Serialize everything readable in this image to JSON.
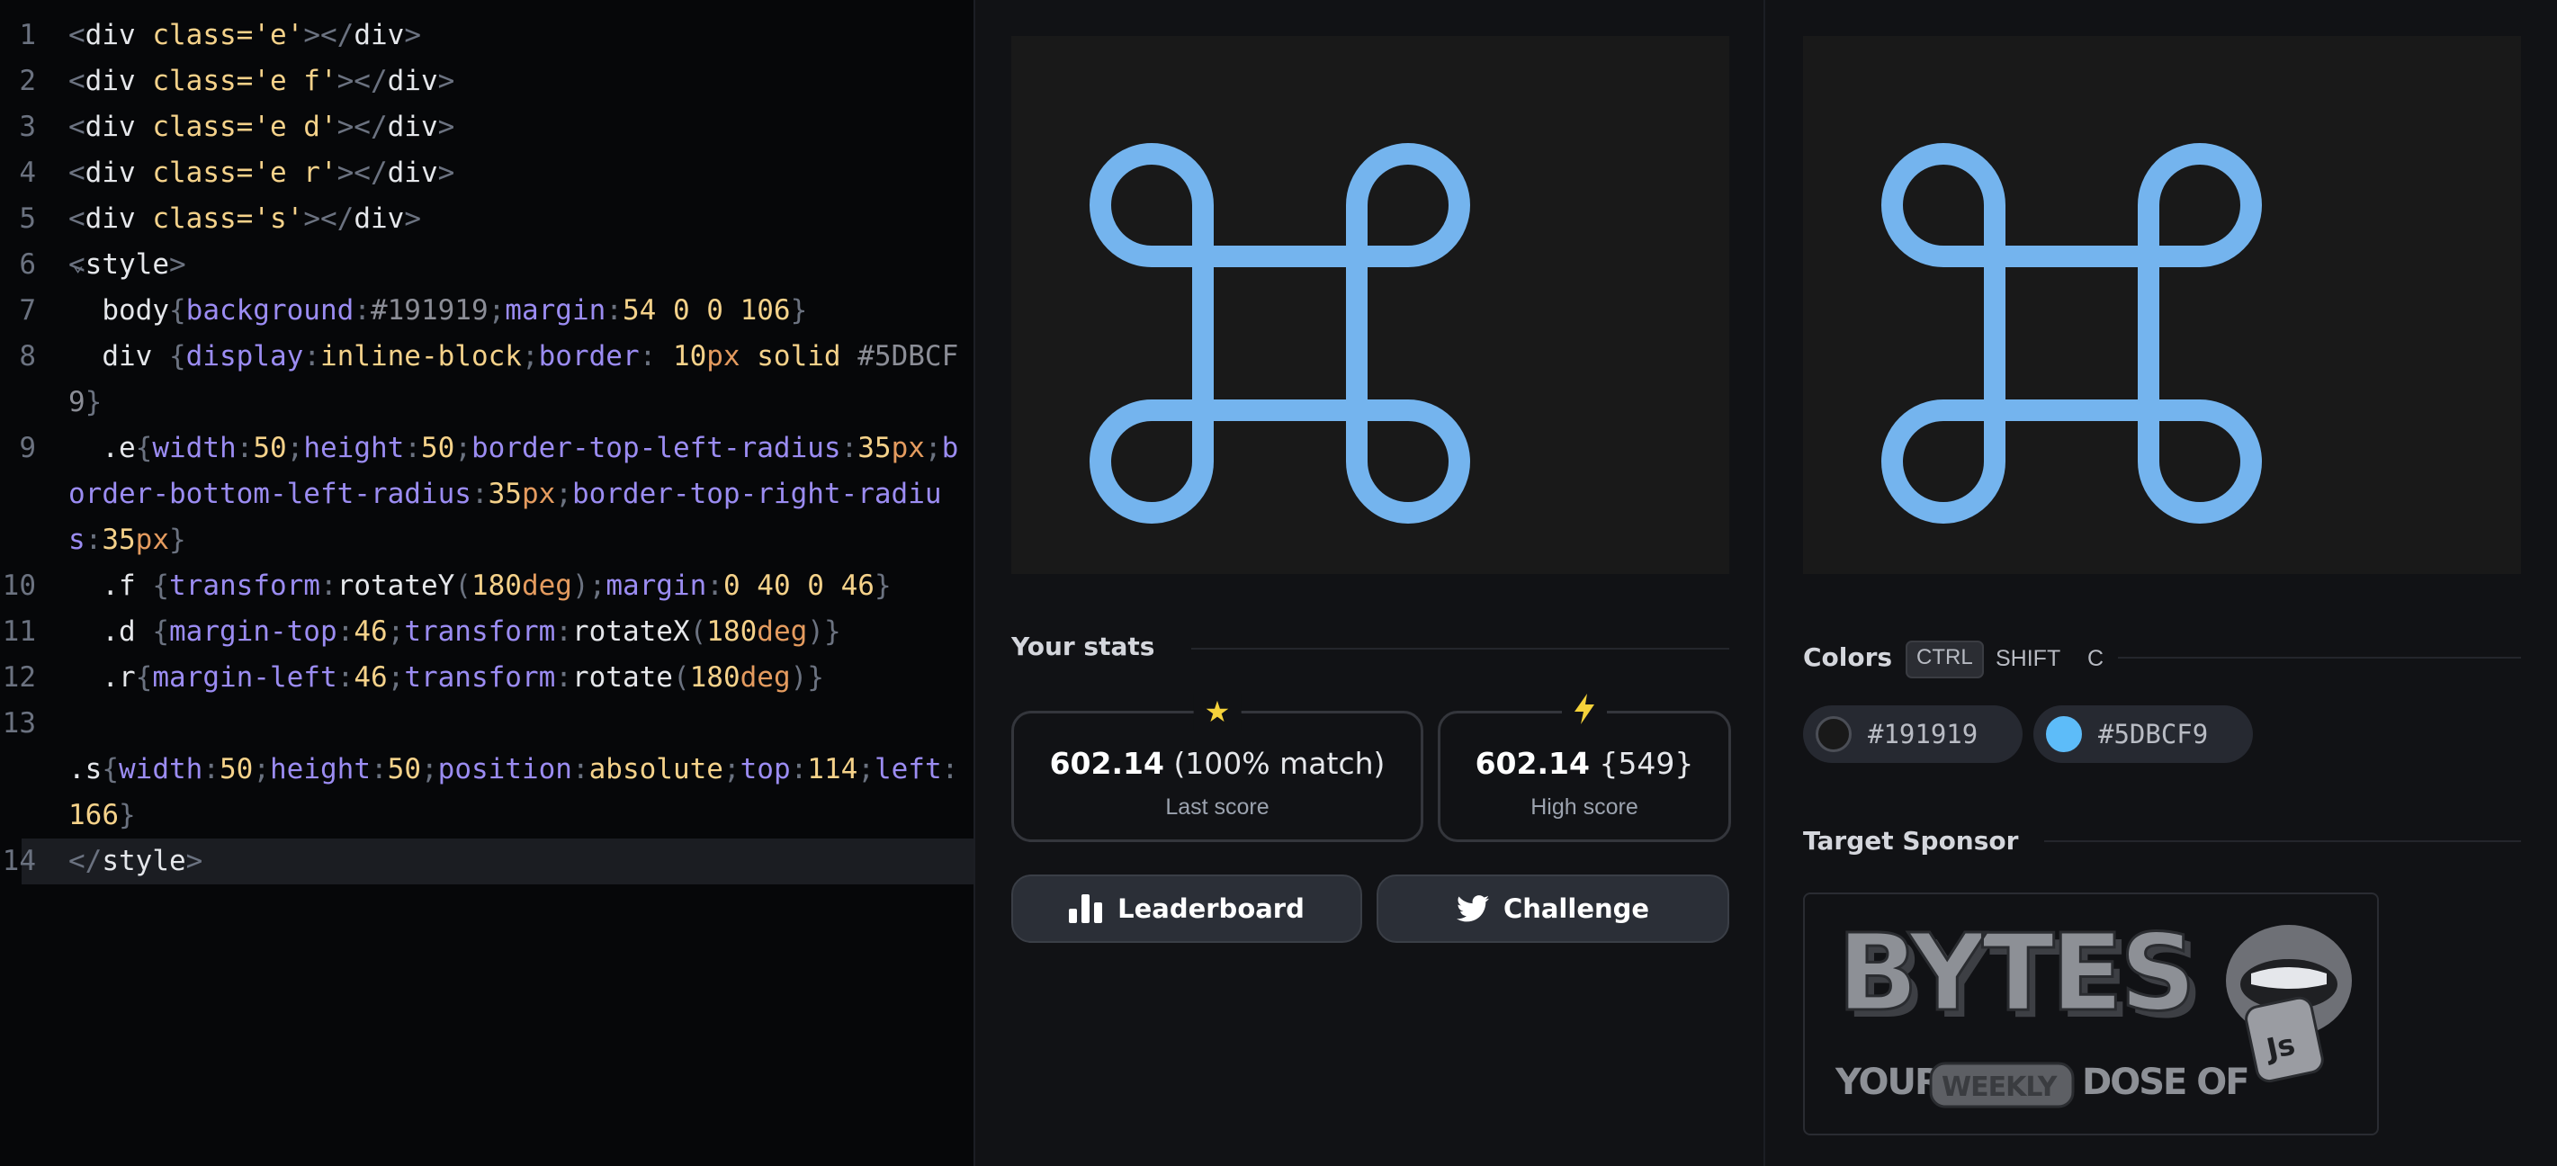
{
  "editor": {
    "lines": [
      {
        "n": "1",
        "parts": [
          [
            "t-punc",
            "<"
          ],
          [
            "t-tag",
            "div "
          ],
          [
            "t-attr",
            "class="
          ],
          [
            "t-str",
            "'e'"
          ],
          [
            "t-punc",
            "></"
          ],
          [
            "t-tag",
            "div"
          ],
          [
            "t-punc",
            ">"
          ]
        ]
      },
      {
        "n": "2",
        "parts": [
          [
            "t-punc",
            "<"
          ],
          [
            "t-tag",
            "div "
          ],
          [
            "t-attr",
            "class="
          ],
          [
            "t-str",
            "'e f'"
          ],
          [
            "t-punc",
            "></"
          ],
          [
            "t-tag",
            "div"
          ],
          [
            "t-punc",
            ">"
          ]
        ]
      },
      {
        "n": "3",
        "parts": [
          [
            "t-punc",
            "<"
          ],
          [
            "t-tag",
            "div "
          ],
          [
            "t-attr",
            "class="
          ],
          [
            "t-str",
            "'e d'"
          ],
          [
            "t-punc",
            "></"
          ],
          [
            "t-tag",
            "div"
          ],
          [
            "t-punc",
            ">"
          ]
        ]
      },
      {
        "n": "4",
        "parts": [
          [
            "t-punc",
            "<"
          ],
          [
            "t-tag",
            "div "
          ],
          [
            "t-attr",
            "class="
          ],
          [
            "t-str",
            "'e r'"
          ],
          [
            "t-punc",
            "></"
          ],
          [
            "t-tag",
            "div"
          ],
          [
            "t-punc",
            ">"
          ]
        ]
      },
      {
        "n": "5",
        "parts": [
          [
            "t-punc",
            "<"
          ],
          [
            "t-tag",
            "div "
          ],
          [
            "t-attr",
            "class="
          ],
          [
            "t-str",
            "'s'"
          ],
          [
            "t-punc",
            "></"
          ],
          [
            "t-tag",
            "div"
          ],
          [
            "t-punc",
            ">"
          ]
        ]
      },
      {
        "n": "6",
        "fold": "⌄",
        "parts": [
          [
            "t-punc",
            "<"
          ],
          [
            "t-tag",
            "style"
          ],
          [
            "t-punc",
            ">"
          ]
        ]
      },
      {
        "n": "7",
        "parts": [
          [
            "t-sel",
            "  body"
          ],
          [
            "t-punc",
            "{"
          ],
          [
            "t-prop",
            "background"
          ],
          [
            "t-punc",
            ":"
          ],
          [
            "t-hex",
            "#191919"
          ],
          [
            "t-punc",
            ";"
          ],
          [
            "t-prop",
            "margin"
          ],
          [
            "t-punc",
            ":"
          ],
          [
            "t-val",
            "54 0 0 106"
          ],
          [
            "t-punc",
            "}"
          ]
        ]
      },
      {
        "n": "8",
        "parts": [
          [
            "t-sel",
            "  div "
          ],
          [
            "t-punc",
            "{"
          ],
          [
            "t-prop",
            "display"
          ],
          [
            "t-punc",
            ":"
          ],
          [
            "t-val",
            "inline-block"
          ],
          [
            "t-punc",
            ";"
          ],
          [
            "t-prop",
            "border"
          ],
          [
            "t-punc",
            ": "
          ],
          [
            "t-val",
            "10"
          ],
          [
            "t-unit",
            "px"
          ],
          [
            "t-val",
            " solid "
          ],
          [
            "t-hex",
            "#5DBCF9"
          ],
          [
            "t-punc",
            "}"
          ]
        ]
      },
      {
        "n": "9",
        "parts": [
          [
            "t-sel",
            "  .e"
          ],
          [
            "t-punc",
            "{"
          ],
          [
            "t-prop",
            "width"
          ],
          [
            "t-punc",
            ":"
          ],
          [
            "t-val",
            "50"
          ],
          [
            "t-punc",
            ";"
          ],
          [
            "t-prop",
            "height"
          ],
          [
            "t-punc",
            ":"
          ],
          [
            "t-val",
            "50"
          ],
          [
            "t-punc",
            ";"
          ],
          [
            "t-prop",
            "border-top-left-radius"
          ],
          [
            "t-punc",
            ":"
          ],
          [
            "t-val",
            "35"
          ],
          [
            "t-unit",
            "px"
          ],
          [
            "t-punc",
            ";"
          ],
          [
            "t-prop",
            "border-bottom-left-radius"
          ],
          [
            "t-punc",
            ":"
          ],
          [
            "t-val",
            "35"
          ],
          [
            "t-unit",
            "px"
          ],
          [
            "t-punc",
            ";"
          ],
          [
            "t-prop",
            "border-top-right-radius"
          ],
          [
            "t-punc",
            ":"
          ],
          [
            "t-val",
            "35"
          ],
          [
            "t-unit",
            "px"
          ],
          [
            "t-punc",
            "}"
          ]
        ]
      },
      {
        "n": "10",
        "parts": [
          [
            "t-sel",
            "  .f "
          ],
          [
            "t-punc",
            "{"
          ],
          [
            "t-prop",
            "transform"
          ],
          [
            "t-punc",
            ":"
          ],
          [
            "t-fn",
            "rotateY"
          ],
          [
            "t-punc",
            "("
          ],
          [
            "t-val",
            "180"
          ],
          [
            "t-unit",
            "deg"
          ],
          [
            "t-punc",
            ");"
          ],
          [
            "t-prop",
            "margin"
          ],
          [
            "t-punc",
            ":"
          ],
          [
            "t-val",
            "0 40 0 46"
          ],
          [
            "t-punc",
            "}"
          ]
        ]
      },
      {
        "n": "11",
        "parts": [
          [
            "t-sel",
            "  .d "
          ],
          [
            "t-punc",
            "{"
          ],
          [
            "t-prop",
            "margin-top"
          ],
          [
            "t-punc",
            ":"
          ],
          [
            "t-val",
            "46"
          ],
          [
            "t-punc",
            ";"
          ],
          [
            "t-prop",
            "transform"
          ],
          [
            "t-punc",
            ":"
          ],
          [
            "t-fn",
            "rotateX"
          ],
          [
            "t-punc",
            "("
          ],
          [
            "t-val",
            "180"
          ],
          [
            "t-unit",
            "deg"
          ],
          [
            "t-punc",
            ")}"
          ]
        ]
      },
      {
        "n": "12",
        "parts": [
          [
            "t-sel",
            "  .r"
          ],
          [
            "t-punc",
            "{"
          ],
          [
            "t-prop",
            "margin-left"
          ],
          [
            "t-punc",
            ":"
          ],
          [
            "t-val",
            "46"
          ],
          [
            "t-punc",
            ";"
          ],
          [
            "t-prop",
            "transform"
          ],
          [
            "t-punc",
            ":"
          ],
          [
            "t-fn",
            "rotate"
          ],
          [
            "t-punc",
            "("
          ],
          [
            "t-val",
            "180"
          ],
          [
            "t-unit",
            "deg"
          ],
          [
            "t-punc",
            ")}"
          ]
        ]
      },
      {
        "n": "13",
        "parts": [
          [
            "t-com",
            "\n"
          ],
          [
            "t-sel",
            ".s"
          ],
          [
            "t-punc",
            "{"
          ],
          [
            "t-prop",
            "width"
          ],
          [
            "t-punc",
            ":"
          ],
          [
            "t-val",
            "50"
          ],
          [
            "t-punc",
            ";"
          ],
          [
            "t-prop",
            "height"
          ],
          [
            "t-punc",
            ":"
          ],
          [
            "t-val",
            "50"
          ],
          [
            "t-punc",
            ";"
          ],
          [
            "t-prop",
            "position"
          ],
          [
            "t-punc",
            ":"
          ],
          [
            "t-val",
            "absolute"
          ],
          [
            "t-punc",
            ";"
          ],
          [
            "t-prop",
            "top"
          ],
          [
            "t-punc",
            ":"
          ],
          [
            "t-val",
            "114"
          ],
          [
            "t-punc",
            ";"
          ],
          [
            "t-prop",
            "left"
          ],
          [
            "t-punc",
            ":"
          ],
          [
            "t-val",
            "166"
          ],
          [
            "t-punc",
            "}"
          ]
        ]
      },
      {
        "n": "14",
        "active": true,
        "parts": [
          [
            "t-punc",
            "</"
          ],
          [
            "t-tag",
            "style"
          ],
          [
            "t-punc",
            ">"
          ]
        ]
      }
    ]
  },
  "stats": {
    "title": "Your stats",
    "last": {
      "score": "602.14",
      "detail": "(100% match)",
      "label": "Last score",
      "icon": "star-icon"
    },
    "high": {
      "score": "602.14",
      "detail": "{549}",
      "label": "High score",
      "icon": "bolt-icon"
    }
  },
  "buttons": {
    "leaderboard": "Leaderboard",
    "challenge": "Challenge"
  },
  "colors": {
    "title": "Colors",
    "shortcut": [
      "CTRL",
      "SHIFT",
      "C"
    ],
    "swatches": [
      {
        "hex": "#191919",
        "color": "#191919"
      },
      {
        "hex": "#5DBCF9",
        "color": "#5DBCF9"
      }
    ]
  },
  "sponsor": {
    "title": "Target Sponsor",
    "logo_text": "BYTES",
    "tagline_left": "YOUR",
    "tagline_pill": "WEEKLY",
    "tagline_right": "DOSE OF",
    "badge": "Js"
  },
  "palette": {
    "symbol": "#74b4ee",
    "preview_bg": "#191919",
    "star": "#f5d23a",
    "bolt": "#f5d23a"
  }
}
